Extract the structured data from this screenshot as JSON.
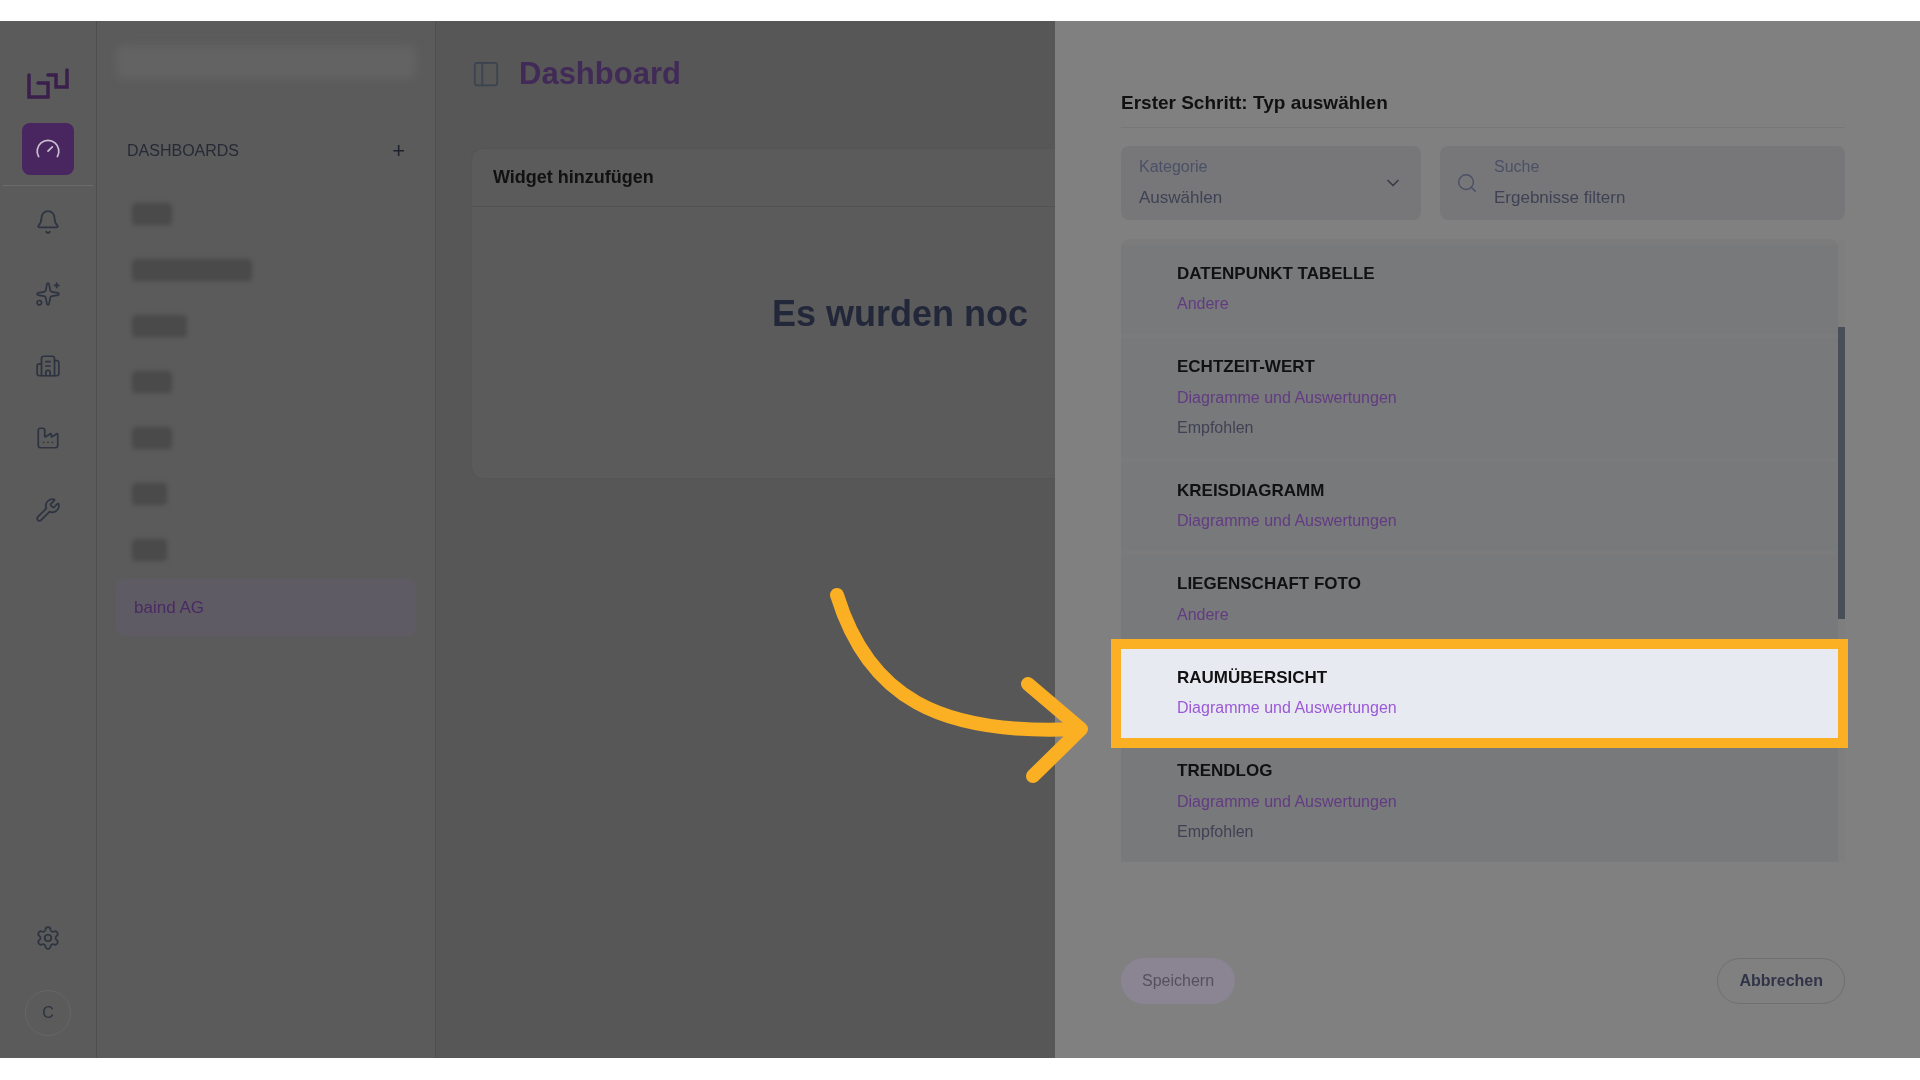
{
  "rail": {
    "items": [
      {
        "kind": "dashboard",
        "selected": true
      },
      {
        "kind": "bell",
        "selected": false
      },
      {
        "kind": "sparkles",
        "selected": false
      },
      {
        "kind": "building",
        "selected": false
      },
      {
        "kind": "factory",
        "selected": false
      },
      {
        "kind": "wrench",
        "selected": false
      }
    ],
    "avatar": "C"
  },
  "dashboards": {
    "heading": "DASHBOARDS",
    "add": "+",
    "items": [
      {
        "label": "baind AG",
        "selected": true
      }
    ]
  },
  "page": {
    "title": "Dashboard"
  },
  "widget_card": {
    "title": "Widget hinzufügen",
    "empty_text": "Es wurden noc"
  },
  "panel": {
    "step_title": "Erster Schritt: Typ auswählen",
    "category": {
      "label": "Kategorie",
      "placeholder": "Auswählen"
    },
    "search": {
      "label": "Suche",
      "placeholder": "Ergebnisse filtern"
    },
    "types": [
      {
        "name": "DATENPUNKT TABELLE",
        "category": "Andere",
        "selected": false
      },
      {
        "name": "ECHTZEIT-WERT",
        "category": "Diagramme und Auswertungen",
        "tag": "Empfohlen",
        "selected": false
      },
      {
        "name": "KREISDIAGRAMM",
        "category": "Diagramme und Auswertungen",
        "selected": false
      },
      {
        "name": "LIEGENSCHAFT FOTO",
        "category": "Andere",
        "selected": false
      },
      {
        "name": "RAUMÜBERSICHT",
        "category": "Diagramme und Auswertungen",
        "selected": true
      },
      {
        "name": "TRENDLOG",
        "category": "Diagramme und Auswertungen",
        "tag": "Empfohlen",
        "selected": false
      }
    ],
    "buttons": [
      {
        "label": "Speichern",
        "disabled": true
      },
      {
        "label": "Abbrechen",
        "disabled": false
      }
    ]
  }
}
